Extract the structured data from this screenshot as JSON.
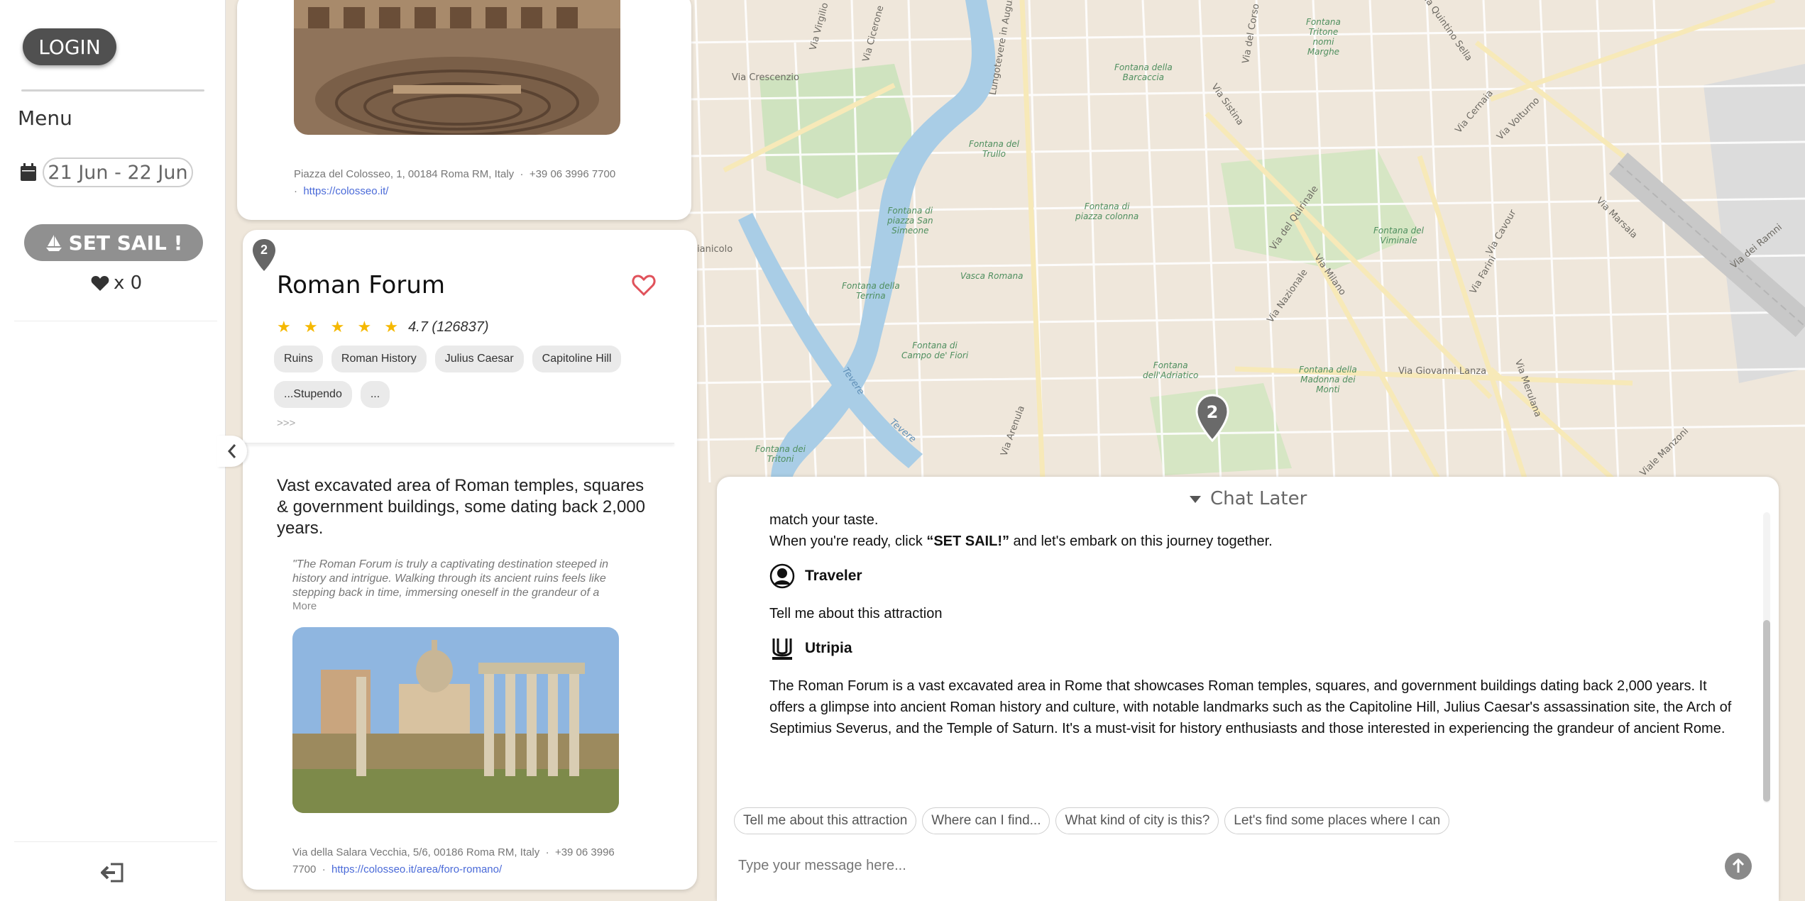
{
  "sidebar": {
    "login_label": "LOGIN",
    "menu_title": "Menu",
    "date_range": "21 Jun - 22 Jun",
    "sail_label": "SET SAIL !",
    "favorites_count": "x 0"
  },
  "cards": {
    "prev": {
      "address": "Piazza del Colosseo, 1, 00184 Roma RM, Italy",
      "phone": "+39 06 3996 7700",
      "website": "https://colosseo.it/"
    },
    "current": {
      "pin_number": "2",
      "title": "Roman Forum",
      "stars": "★ ★ ★ ★ ★",
      "rating_text": "4.7 (126837)",
      "tags": [
        "Ruins",
        "Roman History",
        "Julius Caesar",
        "Capitoline Hill",
        "...Stupendo",
        "..."
      ],
      "expand": ">>>",
      "description": "Vast excavated area of Roman temples, squares & government buildings, some dating back 2,000 years.",
      "review": "\"The Roman Forum is truly a captivating destination steeped in history and intrigue. Walking through its ancient ruins feels like stepping back in time, immersing oneself in the grandeur of a",
      "review_more": "More",
      "address": "Via della Salara Vecchia, 5/6, 00186 Roma RM, Italy",
      "phone": "+39 06 3996 7700",
      "website": "https://colosseo.it/area/foro-romano/"
    }
  },
  "map": {
    "marker_number": "2",
    "streets": [
      "Via Crescenzio",
      "Via Virgilio",
      "Via Cicerone",
      "Lungotevere in Augusta",
      "Via del Corso",
      "Via Sistina",
      "Via Cernaia",
      "Via Volturno",
      "Via Marsala",
      "Via dei Ramni",
      "Via del Quirinale",
      "Via Nazionale",
      "Via Milano",
      "Via Cavour",
      "Via Farini",
      "Via Merulana",
      "Via Giovanni Lanza",
      "Via Arenula",
      "Viale Manzoni",
      "Via Quintino Sella",
      "Gianicolo",
      "Tevere"
    ],
    "fountains": [
      "Fontana della Barcaccia",
      "Fontana del Tritone",
      "Fontana del Trullo",
      "Fontana di piazza San Simeone",
      "Fontana di piazza colonna",
      "Fontana del Viminale",
      "Fontana della Terrina",
      "Vasca Romana",
      "Fontana di Campo de' Fiori",
      "Fontana dell'Adriatico",
      "Fontana della Madonna dei Monti",
      "Fontana dei Tritoni"
    ]
  },
  "chat": {
    "header": "Chat Later",
    "intro_line1": "match your taste.",
    "intro_line2_pre": "When you're ready, click ",
    "intro_line2_bold": "“SET SAIL!”",
    "intro_line2_post": " and let's embark on this journey together.",
    "traveler_name": "Traveler",
    "traveler_message": "Tell me about this attraction",
    "bot_name": "Utripia",
    "bot_message": "The Roman Forum is a vast excavated area in Rome that showcases Roman temples, squares, and government buildings dating back 2,000 years. It offers a glimpse into ancient Roman history and culture, with notable landmarks such as the Capitoline Hill, Julius Caesar's assassination site, the Arch of Septimius Severus, and the Temple of Saturn. It's a must-visit for history enthusiasts and those interested in experiencing the grandeur of ancient Rome.",
    "suggestions": [
      "Tell me about this attraction",
      "Where can I find...",
      "What kind of city is this?",
      "Let's find some places where I can"
    ],
    "input_placeholder": "Type your message here..."
  }
}
